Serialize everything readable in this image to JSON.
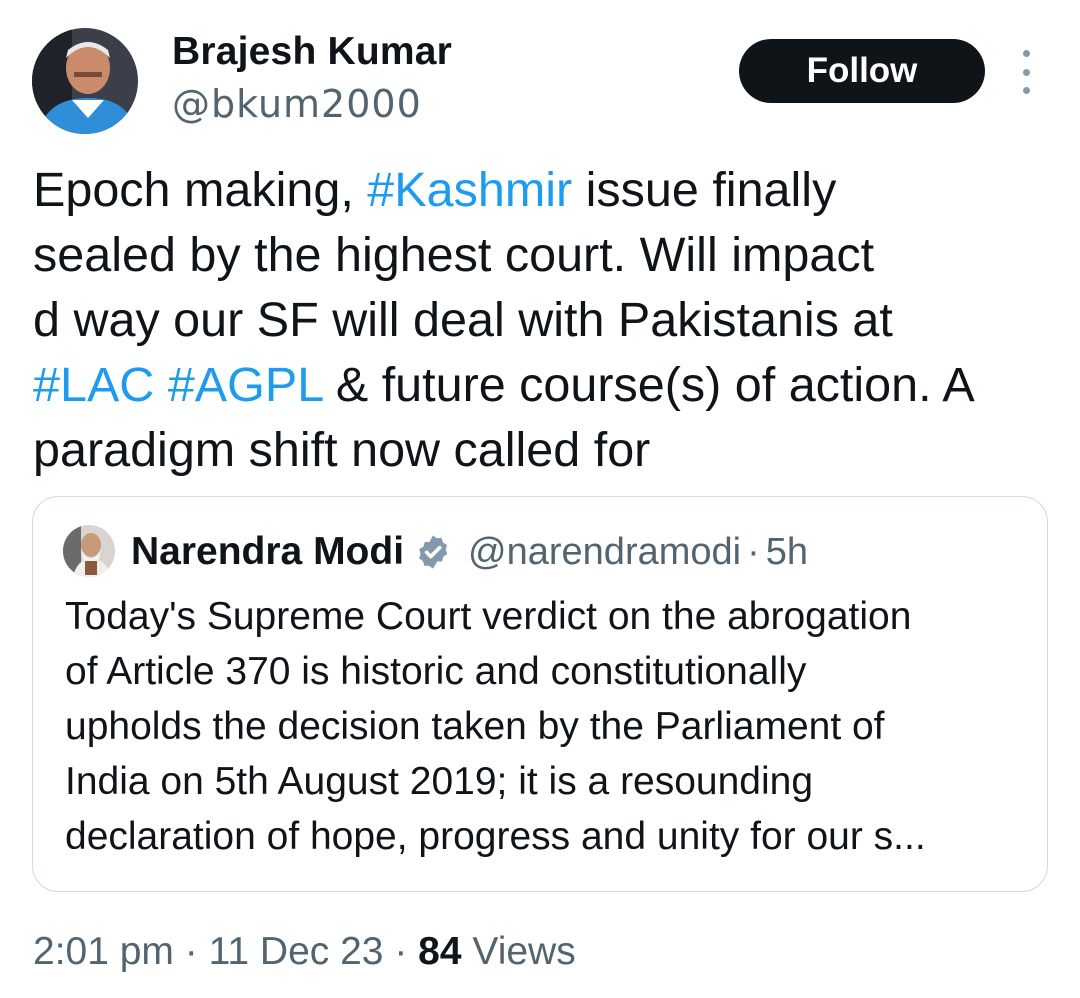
{
  "author": {
    "name": "Brajesh Kumar",
    "handle": "@bkum2000",
    "follow_label": "Follow"
  },
  "tweet": {
    "lines": [
      [
        {
          "text": "Epoch making, ",
          "tag": false
        },
        {
          "text": "#Kashmir",
          "tag": true
        },
        {
          "text": " issue finally",
          "tag": false
        }
      ],
      [
        {
          "text": "sealed by the highest court. Will impact",
          "tag": false
        }
      ],
      [
        {
          "text": "d way our SF will deal with Pakistanis at",
          "tag": false
        }
      ],
      [
        {
          "text": "#LAC",
          "tag": true
        },
        {
          "text": " ",
          "tag": false
        },
        {
          "text": "#AGPL",
          "tag": true
        },
        {
          "text": " & future course(s) of action. A",
          "tag": false
        }
      ],
      [
        {
          "text": "paradigm shift now called for",
          "tag": false
        }
      ]
    ]
  },
  "quoted": {
    "name": "Narendra Modi",
    "handle": "@narendramodi",
    "separator": "·",
    "time": "5h",
    "lines": [
      "Today's Supreme Court verdict on the abrogation",
      "of Article 370 is historic and constitutionally",
      "upholds the decision taken by the Parliament of",
      "India on 5th August 2019; it is a resounding",
      "declaration of hope, progress and unity for our s..."
    ]
  },
  "meta": {
    "time": "2:01 pm",
    "sep1": " · ",
    "date": "11 Dec 23",
    "sep2": " · ",
    "views_count": "84",
    "views_label": " Views"
  },
  "colors": {
    "hashtag": "#1d9bf0",
    "text": "#0f1419",
    "secondary": "#536471",
    "follow_bg": "#0f1419",
    "verified": "#829aab",
    "border": "#cfd9de"
  }
}
